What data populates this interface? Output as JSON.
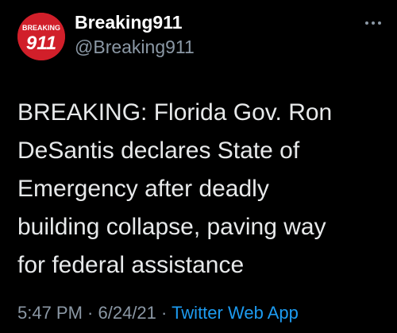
{
  "tweet": {
    "avatar": {
      "logo_top_text": "BREAKING",
      "logo_number": "911",
      "color": "#d11f2a"
    },
    "author": {
      "display_name": "Breaking911",
      "handle": "@Breaking911"
    },
    "more_icon": "more-dots-icon",
    "text_lines": [
      "BREAKING: Florida Gov. Ron",
      "DeSantis declares State of",
      "Emergency after deadly",
      "building collapse, paving way",
      "for federal assistance"
    ],
    "time": "5:47 PM",
    "separator1": " · ",
    "date": "6/24/21",
    "separator2": " · ",
    "source": "Twitter Web App"
  },
  "colors": {
    "background": "#000000",
    "text": "#e7e9ea",
    "muted": "#8b98a5",
    "link": "#1d9bf0"
  }
}
